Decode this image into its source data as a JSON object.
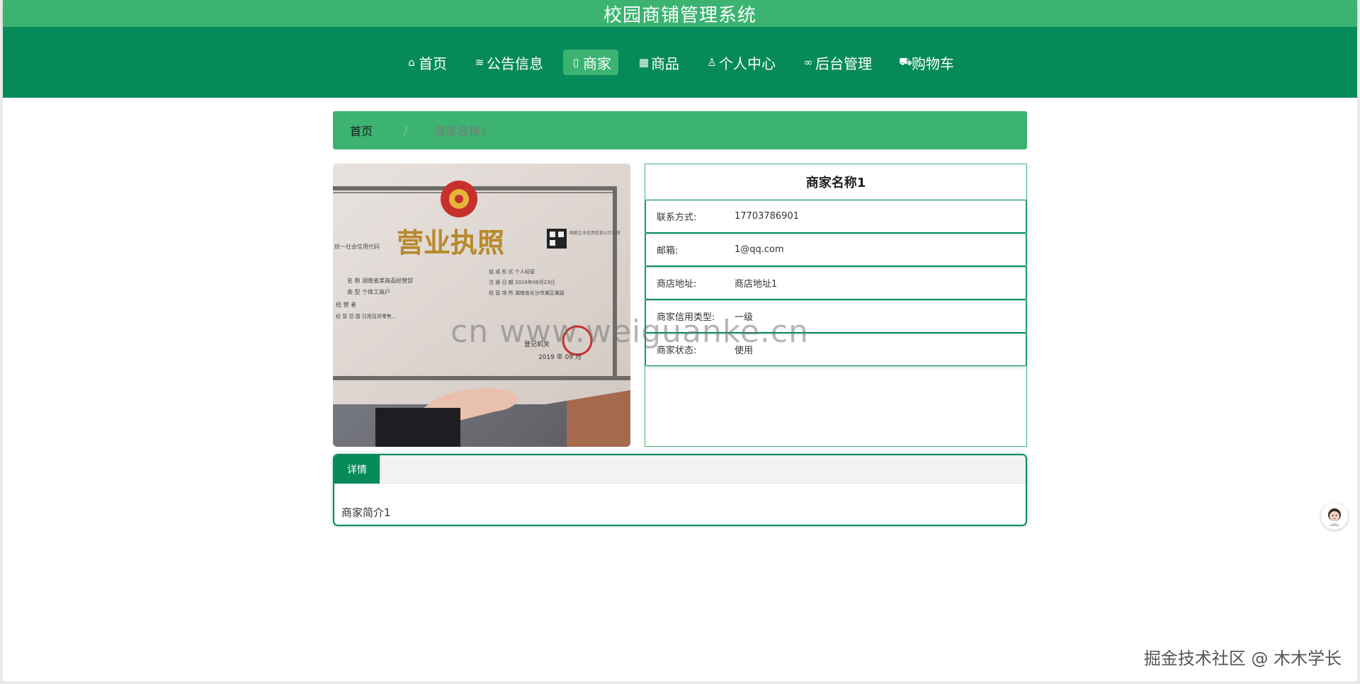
{
  "app": {
    "title": "校园商铺管理系统"
  },
  "nav": {
    "items": [
      {
        "label": "首页",
        "icon": "home-icon",
        "glyph": "⌂",
        "active": false
      },
      {
        "label": "公告信息",
        "icon": "layers-icon",
        "glyph": "≋",
        "active": false
      },
      {
        "label": "商家",
        "icon": "document-icon",
        "glyph": "▯",
        "active": true
      },
      {
        "label": "商品",
        "icon": "calendar-icon",
        "glyph": "▦",
        "active": false
      },
      {
        "label": "个人中心",
        "icon": "user-icon",
        "glyph": "♙",
        "active": false
      },
      {
        "label": "后台管理",
        "icon": "link-icon",
        "glyph": "∞",
        "active": false
      },
      {
        "label": "购物车",
        "icon": "cart-icon",
        "glyph": "⛟",
        "active": false
      }
    ]
  },
  "breadcrumb": {
    "home": "首页",
    "separator": "/",
    "current": "商家名称1"
  },
  "license_image": {
    "heading": "营业执照",
    "qr_caption": "国家企业信用信息公示系统",
    "left_caption": "统一社会信用代码",
    "field_lines": [
      "名 称  湖南省某商品经营部",
      "类 型  个体工商户",
      "经 营 者",
      "经 营 范 围  日用百货零售..."
    ],
    "right_lines": [
      "组 成 形 式  个人经营",
      "注 册 日 期  2019年08月23日",
      "经 营 场 所  湖南省长沙市某区某路"
    ],
    "issuer": "登记机关",
    "year": "2019 年 09 月"
  },
  "merchant": {
    "name": "商家名称1",
    "fields": [
      {
        "label": "联系方式:",
        "value": "17703786901"
      },
      {
        "label": "邮箱:",
        "value": "1@qq.com"
      },
      {
        "label": "商店地址:",
        "value": "商店地址1"
      },
      {
        "label": "商家信用类型:",
        "value": "一级"
      },
      {
        "label": "商家状态:",
        "value": "使用"
      }
    ]
  },
  "details": {
    "tab_label": "详情",
    "content": "商家简介1"
  },
  "watermarks": {
    "center": "cn www.weiguanke.cn",
    "bottom_right": "掘金技术社区 @ 木木学长"
  },
  "colors": {
    "primary": "#3cb371",
    "dark_green": "#078a5a",
    "background": "#ffffff"
  }
}
